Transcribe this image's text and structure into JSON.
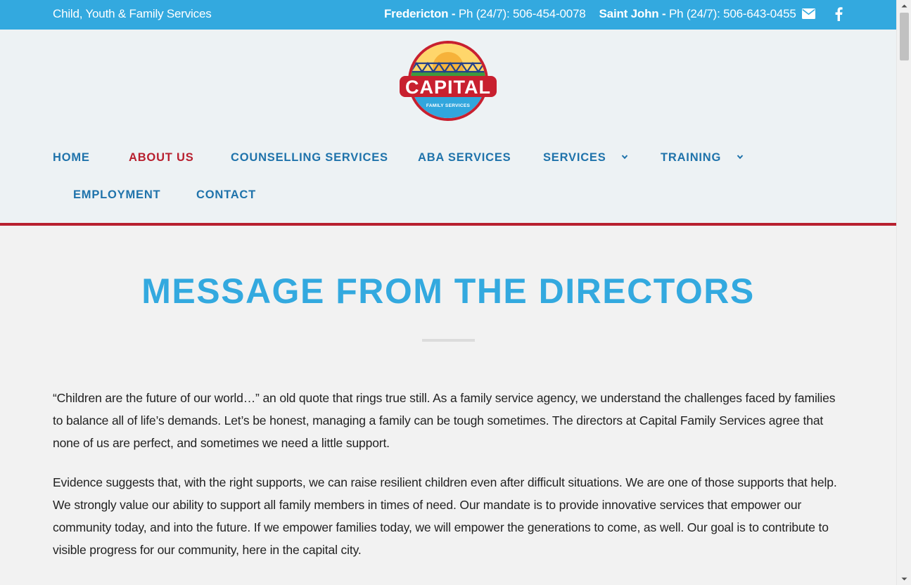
{
  "topbar": {
    "tagline": "Child, Youth & Family Services",
    "phones": [
      {
        "city": "Fredericton -",
        "number": "Ph (24/7): 506-454-0078"
      },
      {
        "city": "Saint John -",
        "number": "Ph (24/7): 506-643-0455"
      }
    ],
    "icons": [
      "envelope-icon",
      "facebook-icon"
    ]
  },
  "logo": {
    "name": "CAPITAL",
    "subtitle": "FAMILY SERVICES"
  },
  "nav": {
    "items": [
      {
        "label": "HOME"
      },
      {
        "label": "ABOUT US",
        "active": true
      },
      {
        "label": "COUNSELLING SERVICES"
      },
      {
        "label": "ABA SERVICES"
      },
      {
        "label": "SERVICES",
        "has_dropdown": true
      },
      {
        "label": "TRAINING",
        "has_dropdown": true
      },
      {
        "label": "EMPLOYMENT"
      },
      {
        "label": "CONTACT"
      }
    ]
  },
  "main": {
    "title": "MESSAGE FROM THE DIRECTORS",
    "paragraphs": [
      "“Children are the future of our world…” an old quote that rings true still. As a family service agency, we understand the challenges faced by families to balance all of life’s demands. Let’s be honest, managing a family can be tough sometimes. The directors at Capital Family Services agree that none of us are perfect, and sometimes we need a little support.",
      "Evidence suggests that, with the right supports, we can raise resilient children even after difficult situations. We are one of those supports that help. We strongly value our ability to support all family members in times of need. Our mandate is to provide innovative services that empower our community today, and into the future. If we empower families today, we will empower the generations to come, as well. Our goal is to contribute to visible progress for our community, here in the capital city."
    ]
  },
  "colors": {
    "topbar": "#33a9df",
    "nav_text": "#1f73ab",
    "accent_red": "#b8202f",
    "title": "#33a9df",
    "header_bg": "#edf2f4",
    "page_bg": "#f2f2f2"
  }
}
